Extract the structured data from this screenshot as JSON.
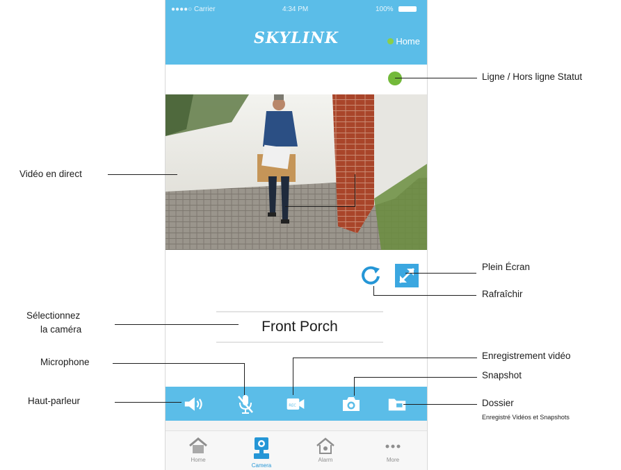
{
  "status_bar": {
    "carrier": "●●●●○ Carrier",
    "time": "4:34 PM",
    "battery": "100%"
  },
  "header": {
    "logo": "SKYLINK",
    "home_link": "Home"
  },
  "video": {
    "icon": "live-video"
  },
  "controls": {
    "refresh_icon": "refresh-icon",
    "fullscreen_icon": "fullscreen-icon"
  },
  "camera_select": {
    "selected": "Front Porch"
  },
  "actions": [
    {
      "name": "speaker",
      "icon": "speaker-icon"
    },
    {
      "name": "microphone",
      "icon": "microphone-muted-icon"
    },
    {
      "name": "record",
      "icon": "video-record-icon"
    },
    {
      "name": "snapshot",
      "icon": "camera-icon"
    },
    {
      "name": "folder",
      "icon": "folder-icon"
    }
  ],
  "tabs": [
    {
      "label": "Home",
      "active": false
    },
    {
      "label": "Camera",
      "active": true
    },
    {
      "label": "Alarm",
      "active": false
    },
    {
      "label": "More",
      "active": false
    }
  ],
  "annotations": {
    "status": "Ligne / Hors ligne Statut",
    "live_video": "Vidéo en direct",
    "fullscreen": "Plein Écran",
    "refresh": "Rafraîchir",
    "select_camera_1": "Sélectionnez",
    "select_camera_2": "la caméra",
    "microphone": "Microphone",
    "video_recording": "Enregistrement vidéo",
    "snapshot": "Snapshot",
    "speaker": "Haut-parleur",
    "folder": "Dossier",
    "folder_sub": "Enregistré Vidéos et Snapshots"
  },
  "colors": {
    "brand_blue": "#5bbde8",
    "online_green": "#73b93a",
    "active_tab": "#2596d6"
  }
}
